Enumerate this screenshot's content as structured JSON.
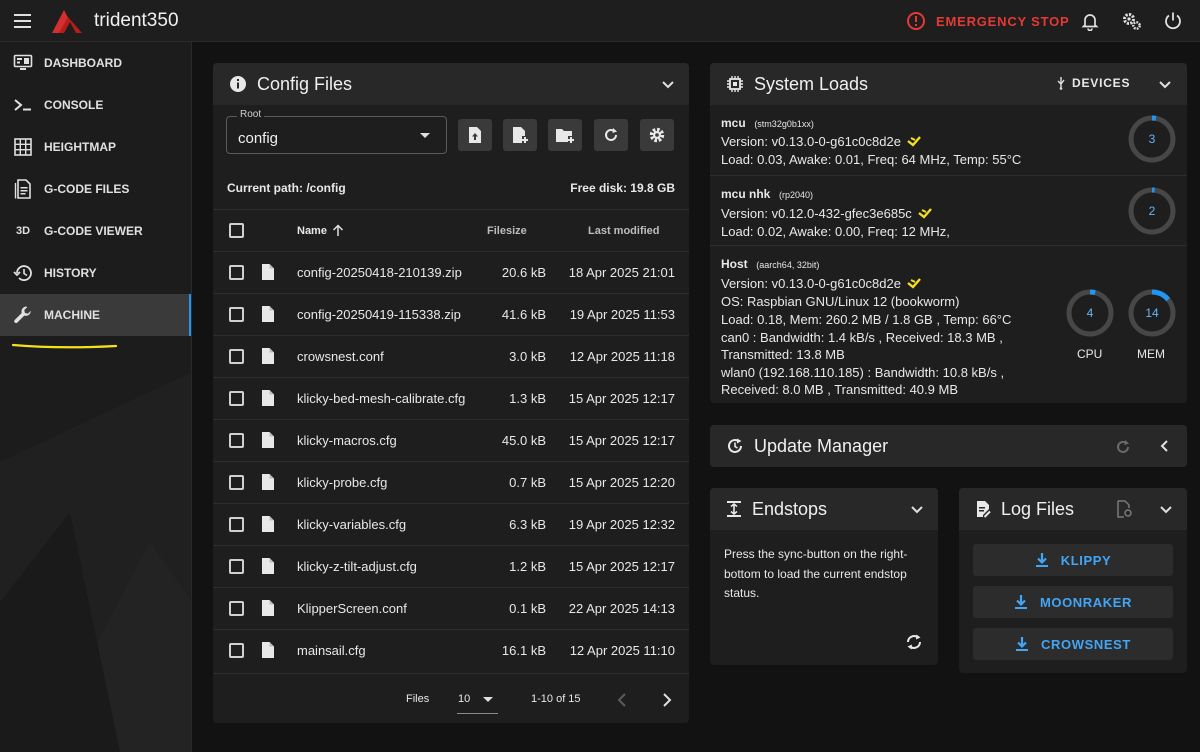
{
  "app": {
    "title": "trident350",
    "emergency_stop": "EMERGENCY STOP",
    "colors": {
      "accent": "#2196f3",
      "danger": "#e53935",
      "logo": "#d32f2f",
      "highlight": "#f5e11b"
    },
    "icons": [
      "menu-icon",
      "logo-icon",
      "alert-circle-icon",
      "bell-icon",
      "cogs-icon",
      "power-icon"
    ]
  },
  "sidebar": {
    "items": [
      {
        "label": "DASHBOARD",
        "icon": "monitor-dashboard-icon"
      },
      {
        "label": "CONSOLE",
        "icon": "console-icon"
      },
      {
        "label": "HEIGHTMAP",
        "icon": "grid-icon"
      },
      {
        "label": "G-CODE FILES",
        "icon": "file-document-icon"
      },
      {
        "label": "G-CODE VIEWER",
        "icon": "3d-icon",
        "icon_text": "3D"
      },
      {
        "label": "HISTORY",
        "icon": "history-icon"
      },
      {
        "label": "MACHINE",
        "icon": "wrench-icon",
        "active": true
      }
    ]
  },
  "config_files": {
    "title": "Config Files",
    "root_label": "Root",
    "root_value": "config",
    "current_path_label": "Current path: /config",
    "free_disk_label": "Free disk: 19.8 GB",
    "columns": {
      "name": "Name",
      "filesize": "Filesize",
      "modified": "Last modified"
    },
    "files": [
      {
        "name": "config-20250418-210139.zip",
        "size": "20.6 kB",
        "modified": "18 Apr 2025 21:01"
      },
      {
        "name": "config-20250419-115338.zip",
        "size": "41.6 kB",
        "modified": "19 Apr 2025 11:53"
      },
      {
        "name": "crowsnest.conf",
        "size": "3.0 kB",
        "modified": "12 Apr 2025 11:18"
      },
      {
        "name": "klicky-bed-mesh-calibrate.cfg",
        "size": "1.3 kB",
        "modified": "15 Apr 2025 12:17"
      },
      {
        "name": "klicky-macros.cfg",
        "size": "45.0 kB",
        "modified": "15 Apr 2025 12:17"
      },
      {
        "name": "klicky-probe.cfg",
        "size": "0.7 kB",
        "modified": "15 Apr 2025 12:20"
      },
      {
        "name": "klicky-variables.cfg",
        "size": "6.3 kB",
        "modified": "19 Apr 2025 12:32"
      },
      {
        "name": "klicky-z-tilt-adjust.cfg",
        "size": "1.2 kB",
        "modified": "15 Apr 2025 12:17"
      },
      {
        "name": "KlipperScreen.conf",
        "size": "0.1 kB",
        "modified": "22 Apr 2025 14:13"
      },
      {
        "name": "mainsail.cfg",
        "size": "16.1 kB",
        "modified": "12 Apr 2025 11:10"
      }
    ],
    "footer": {
      "files_label": "Files",
      "per_page": "10",
      "range": "1-10 of 15"
    }
  },
  "system_loads": {
    "title": "System Loads",
    "devices_label": "DEVICES",
    "mcus": [
      {
        "name": "mcu",
        "chip": "(stm32g0b1xx)",
        "version": "Version: v0.13.0-0-g61c0c8d2e",
        "load": "Load: 0.03, Awake: 0.01, Freq: 64 MHz, Temp: 55°C",
        "gauge": "3",
        "gauge_percent": 3
      },
      {
        "name": "mcu nhk",
        "chip": "(rp2040)",
        "version": "Version: v0.12.0-432-gfec3e685c",
        "load": "Load: 0.02, Awake: 0.00, Freq: 12 MHz,",
        "gauge": "2",
        "gauge_percent": 2
      }
    ],
    "host": {
      "name": "Host",
      "arch": "(aarch64, 32bit)",
      "version": "Version: v0.13.0-0-g61c0c8d2e",
      "os": "OS: Raspbian GNU/Linux 12 (bookworm)",
      "load": "Load: 0.18, Mem: 260.2 MB / 1.8 GB , Temp: 66°C",
      "can0": "can0 : Bandwidth: 1.4 kB/s , Received: 18.3 MB ,",
      "can0_tx": "Transmitted: 13.8 MB",
      "wlan0": "wlan0 (192.168.110.185) : Bandwidth: 10.8 kB/s ,",
      "wlan0_rx": "Received: 8.0 MB , Transmitted: 40.9 MB",
      "cpu": {
        "value": "4",
        "label": "CPU",
        "percent": 4
      },
      "mem": {
        "value": "14",
        "label": "MEM",
        "percent": 14
      }
    }
  },
  "update_manager": {
    "title": "Update Manager"
  },
  "endstops": {
    "title": "Endstops",
    "text": "Press the sync-button on the right-bottom to load the current endstop status."
  },
  "log_files": {
    "title": "Log Files",
    "buttons": [
      "KLIPPY",
      "MOONRAKER",
      "CROWSNEST"
    ]
  }
}
